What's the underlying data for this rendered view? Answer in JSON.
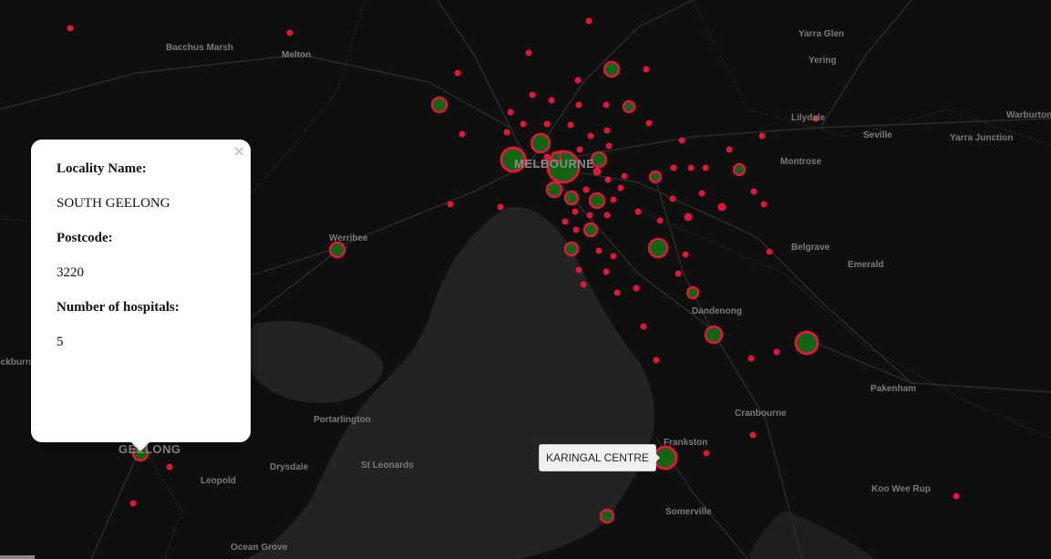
{
  "map": {
    "theme_colors": {
      "land": "#0f0f0f",
      "water": "#232323",
      "marker_stroke": "#e0173a",
      "marker_fill": "#136513"
    },
    "place_labels": [
      "Bacchus Marsh",
      "Melton",
      "Yarra Glen",
      "Yering",
      "Lilydale",
      "Warburton",
      "Seville",
      "Yarra Junction",
      "Montrose",
      "MELBOURNE",
      "Werribee",
      "Belgrave",
      "Emerald",
      "Dandenong",
      "Pakenham",
      "Cranbourne",
      "Portarlington",
      "Drysdale",
      "St Leonards",
      "Leopold",
      "GEELONG",
      "Koo Wee Rup",
      "Somerville",
      "Ocean Grove",
      "Frankston",
      "Bannockburn"
    ]
  },
  "popup": {
    "close_symbol": "×",
    "locality_label": "Locality Name:",
    "locality_value": "SOUTH GEELONG",
    "postcode_label": "Postcode:",
    "postcode_value": "3220",
    "hospitals_label": "Number of hospitals:",
    "hospitals_value": "5"
  },
  "tooltip": {
    "text": "KARINGAL CENTRE"
  }
}
